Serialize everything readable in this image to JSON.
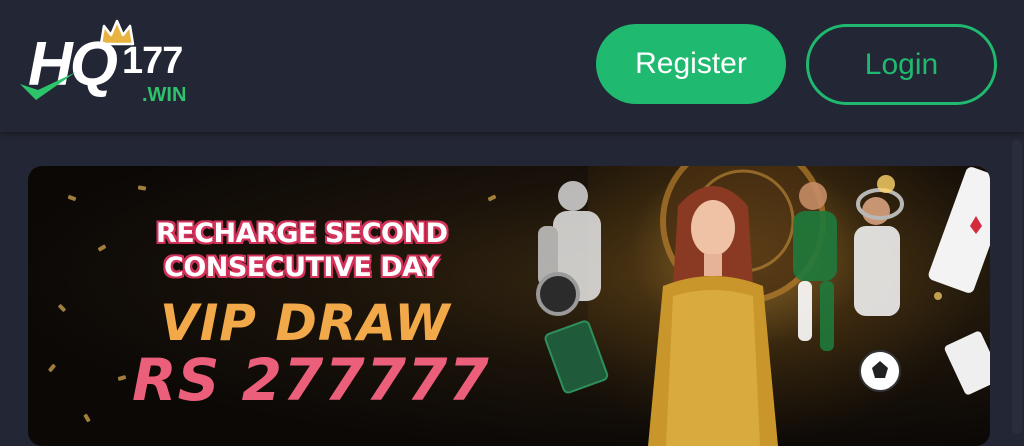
{
  "header": {
    "logo": {
      "main": "HQ",
      "number": "177",
      "suffix": ".WIN"
    },
    "register_label": "Register",
    "login_label": "Login"
  },
  "banner": {
    "line1": "RECHARGE SECOND",
    "line2": "CONSECUTIVE DAY",
    "line3": "VIP DRAW",
    "line4": "RS 277777"
  },
  "colors": {
    "background": "#232634",
    "accent": "#1fb970",
    "headline_outline": "#d3325a",
    "vip_gold": "#f2a94a",
    "amount_pink": "#ec5f7b"
  }
}
